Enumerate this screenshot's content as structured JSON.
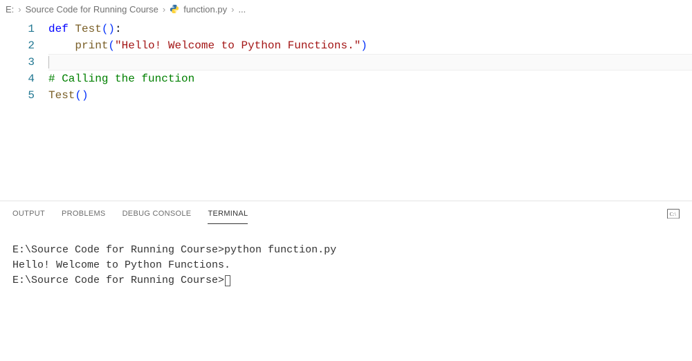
{
  "breadcrumb": {
    "drive": "E:",
    "folder": "Source Code for Running Course",
    "file": "function.py",
    "tail": "..."
  },
  "editor": {
    "line_numbers": [
      "1",
      "2",
      "3",
      "4",
      "5"
    ],
    "lines": {
      "l1": {
        "kw": "def",
        "sp1": " ",
        "fn": "Test",
        "paren": "()",
        "colon": ":"
      },
      "l2": {
        "indent": "    ",
        "call": "print",
        "open": "(",
        "str": "\"Hello! Welcome to Python Functions.\"",
        "close": ")"
      },
      "l3": {
        "indent": "    "
      },
      "l4": {
        "comment": "# Calling the function"
      },
      "l5": {
        "call": "Test",
        "paren": "()"
      }
    }
  },
  "panel": {
    "tabs": {
      "output": "OUTPUT",
      "problems": "PROBLEMS",
      "debug": "DEBUG CONSOLE",
      "terminal": "TERMINAL"
    }
  },
  "terminal": {
    "line1": "E:\\Source Code for Running Course>python function.py",
    "line2": "Hello! Welcome to Python Functions.",
    "line3": "",
    "prompt": "E:\\Source Code for Running Course>"
  }
}
